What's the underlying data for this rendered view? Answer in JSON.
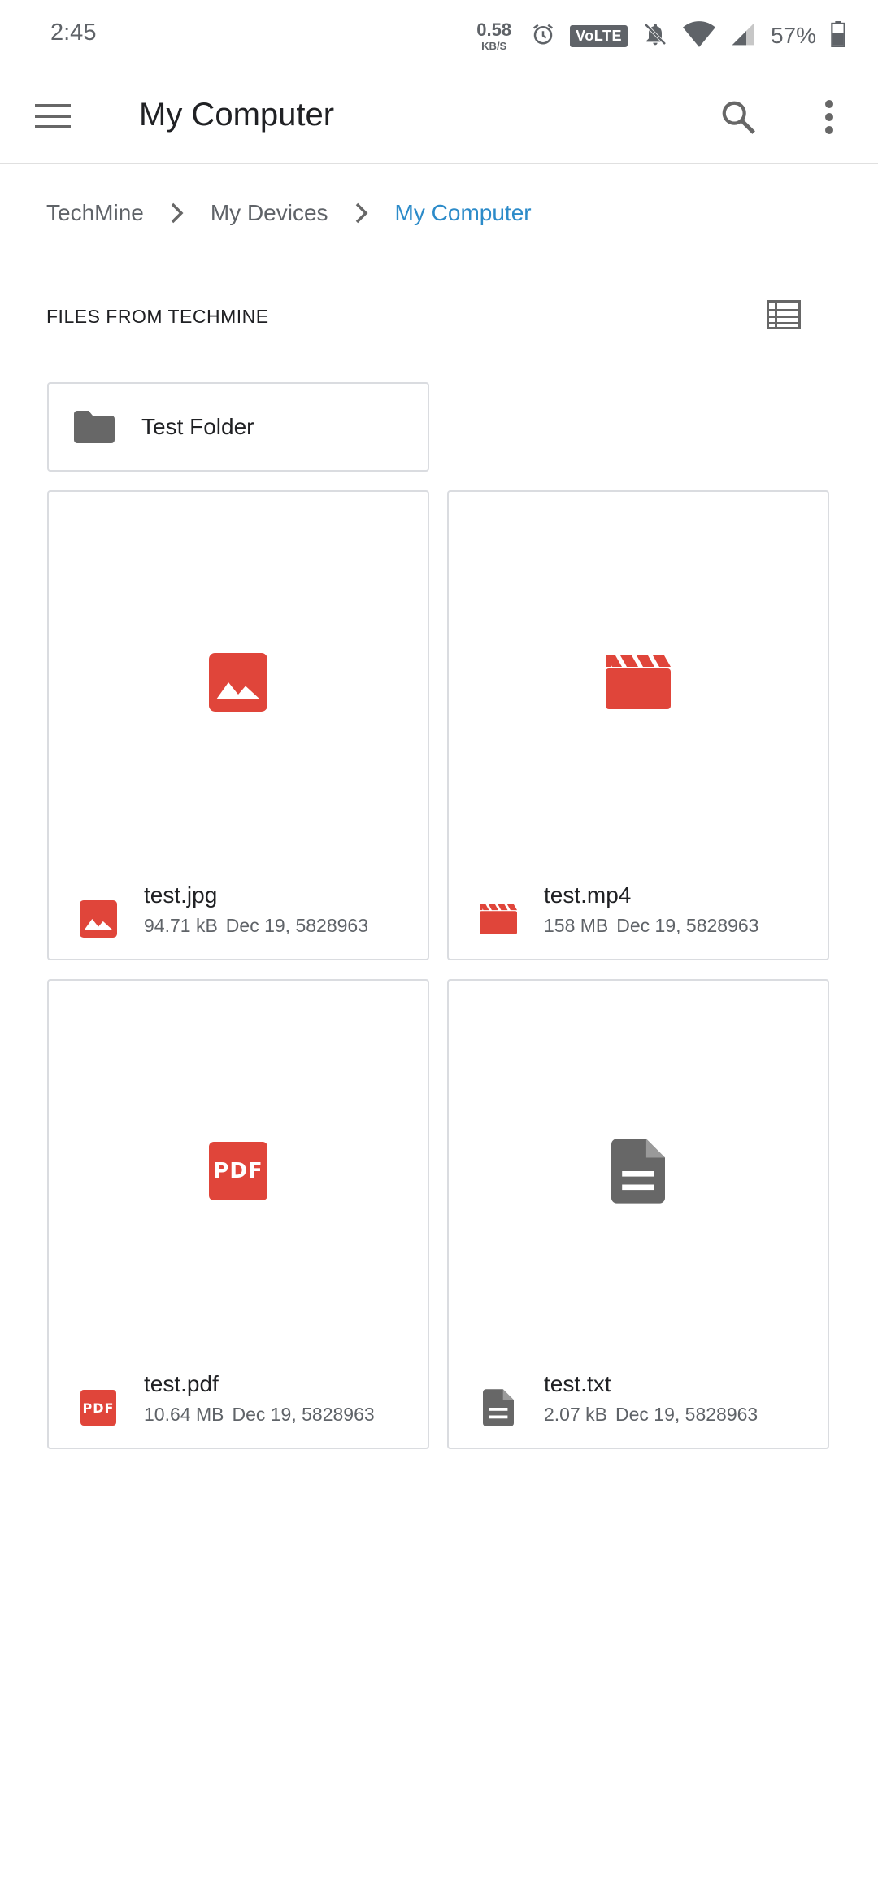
{
  "status_bar": {
    "time": "2:45",
    "speed_value": "0.58",
    "speed_unit": "KB/S",
    "volte": "VoLTE",
    "battery": "57%"
  },
  "app_bar": {
    "title": "My Computer",
    "icons": [
      "menu-icon",
      "search-icon",
      "more-vert-icon"
    ]
  },
  "breadcrumb": {
    "items": [
      "TechMine",
      "My Devices",
      "My Computer"
    ]
  },
  "section": {
    "title": "FILES FROM TECHMINE",
    "view_icon": "list-view-icon"
  },
  "folders": [
    {
      "name": "Test Folder",
      "icon": "folder-icon"
    }
  ],
  "files": [
    {
      "name": "test.jpg",
      "size": "94.71 kB",
      "date": "Dec 19, 5828963",
      "icon": "image-icon"
    },
    {
      "name": "test.mp4",
      "size": "158 MB",
      "date": "Dec 19, 5828963",
      "icon": "video-icon"
    },
    {
      "name": "test.pdf",
      "size": "10.64 MB",
      "date": "Dec 19, 5828963",
      "icon": "pdf-icon",
      "badge": "PDF"
    },
    {
      "name": "test.txt",
      "size": "2.07 kB",
      "date": "Dec 19, 5828963",
      "icon": "text-file-icon"
    }
  ],
  "colors": {
    "accent": "#2c8bc9",
    "file_icon_red": "#e0453a",
    "icon_gray": "#676767",
    "border": "#dadce0"
  }
}
